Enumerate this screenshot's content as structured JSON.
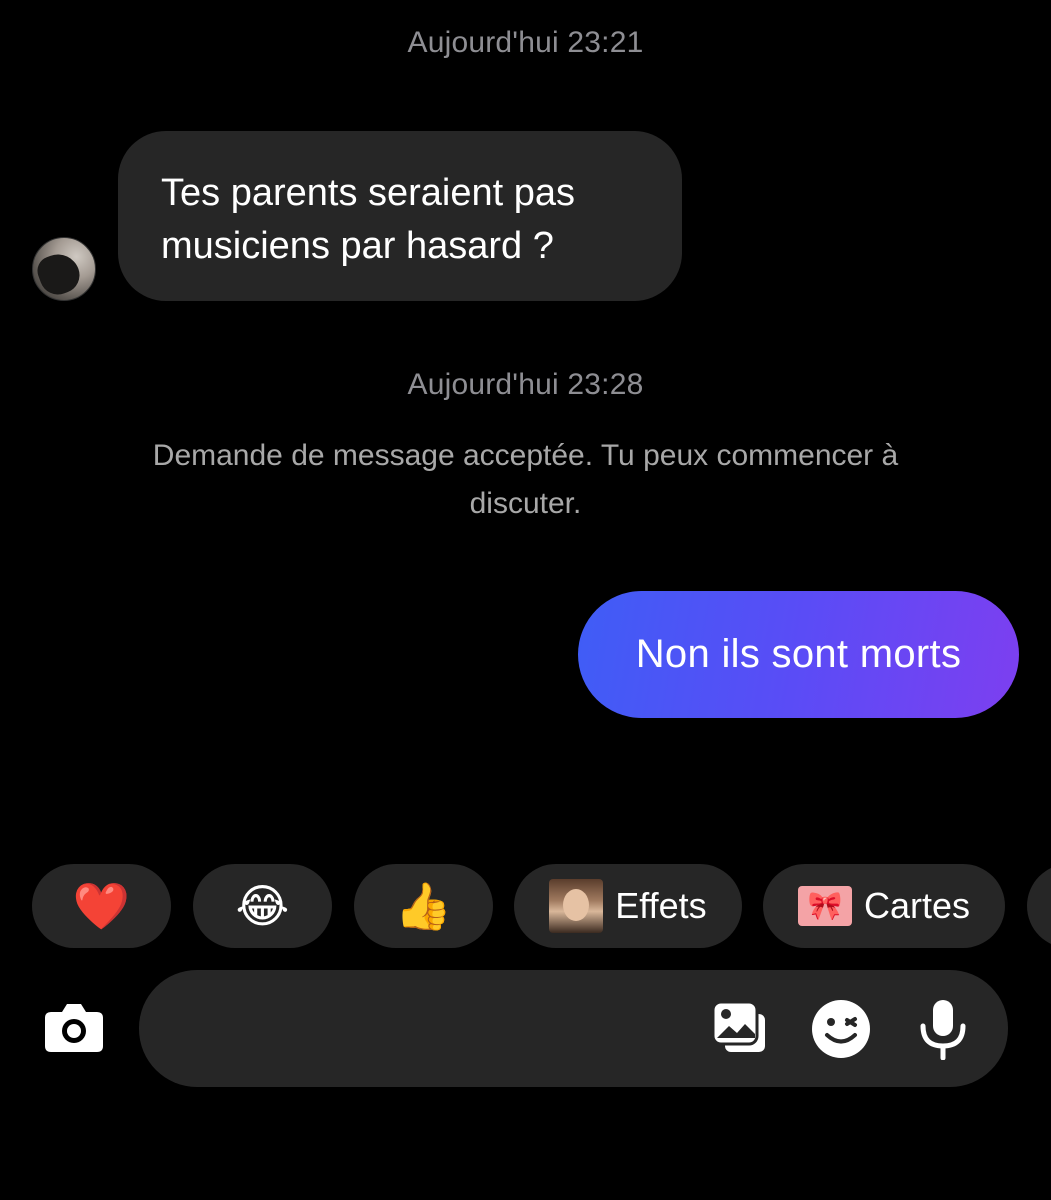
{
  "thread": {
    "timestamp_1": "Aujourd'hui 23:21",
    "incoming_message": "Tes parents seraient pas musiciens par hasard ?",
    "timestamp_2": "Aujourd'hui 23:28",
    "system_message": "Demande de message acceptée. Tu peux commencer à discuter.",
    "outgoing_message": "Non ils sont morts"
  },
  "quick_reactions": {
    "heart": "❤️",
    "laugh": "😂",
    "thumbs_up": "👍",
    "effects_label": "Effets",
    "cards_label": "Cartes"
  },
  "composer": {
    "placeholder": ""
  },
  "icons": {
    "camera": "camera-icon",
    "gallery": "gallery-icon",
    "sticker": "sticker-icon",
    "microphone": "microphone-icon"
  },
  "colors": {
    "background": "#000000",
    "bubble_incoming": "#262626",
    "bubble_outgoing_start": "#3f5df6",
    "bubble_outgoing_end": "#7d3ff0",
    "muted_text": "#8e8e93"
  }
}
